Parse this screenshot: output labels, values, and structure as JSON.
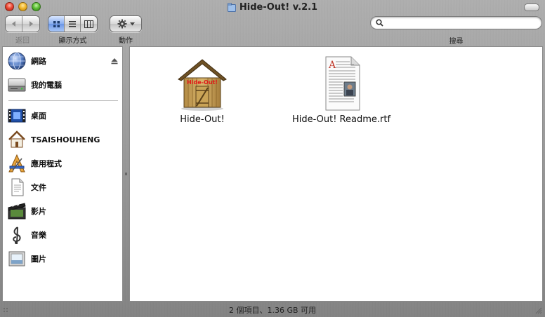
{
  "window": {
    "title": "Hide-Out! v.2.1"
  },
  "toolbar": {
    "back_label": "返回",
    "view_label": "顯示方式",
    "action_label": "動作",
    "search_label": "搜尋",
    "search_placeholder": "",
    "active_view": "icon"
  },
  "sidebar": {
    "devices": [
      {
        "label": "網路",
        "icon": "network-globe-icon",
        "ejectable": true
      },
      {
        "label": "我的電腦",
        "icon": "hard-drive-icon",
        "ejectable": false
      }
    ],
    "places": [
      {
        "label": "桌面",
        "icon": "desktop-icon"
      },
      {
        "label": "TSAISHOUHENG",
        "icon": "home-icon"
      },
      {
        "label": "應用程式",
        "icon": "applications-icon"
      },
      {
        "label": "文件",
        "icon": "documents-icon"
      },
      {
        "label": "影片",
        "icon": "movies-icon"
      },
      {
        "label": "音樂",
        "icon": "music-icon"
      },
      {
        "label": "圖片",
        "icon": "pictures-icon"
      }
    ]
  },
  "content": {
    "items": [
      {
        "name": "Hide-Out!",
        "icon": "hideout-shed-icon",
        "badge": "Hide-Out!"
      },
      {
        "name": "Hide-Out! Readme.rtf",
        "icon": "rtf-document-icon"
      }
    ]
  },
  "status": {
    "text": "2 個項目、1.36 GB 可用"
  },
  "colors": {
    "accent_blue": "#6b96e6",
    "window_metal": "#c8c8c8"
  }
}
